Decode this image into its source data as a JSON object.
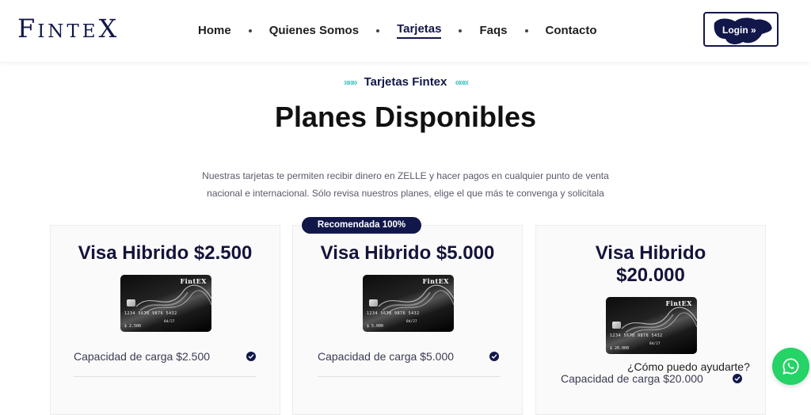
{
  "header": {
    "logo_big": "F",
    "logo_small": "INTE",
    "logo_end": "X",
    "nav": [
      {
        "label": "Home",
        "active": false
      },
      {
        "label": "Quienes Somos",
        "active": false
      },
      {
        "label": "Tarjetas",
        "active": true
      },
      {
        "label": "Faqs",
        "active": false
      },
      {
        "label": "Contacto",
        "active": false
      }
    ],
    "login_label": "Login »"
  },
  "section": {
    "eyebrow": "Tarjetas Fintex",
    "eyebrow_arrows_left": "»»»",
    "eyebrow_arrows_right": "«««",
    "title": "Planes Disponibles",
    "description_line1": "Nuestras tarjetas te permiten recibir dinero en ZELLE y hacer pagos en cualquier punto de venta",
    "description_line2": "nacional e internacional. Sólo revisa nuestros planes, elige el que más te convenga y solicitala"
  },
  "badge": "Recomendada 100%",
  "plans": [
    {
      "name": "Visa Hibrido $2.500",
      "card_brand": "FintEX",
      "card_number": "1234 5678 9876 5432",
      "card_expiry": "04/27",
      "card_amount": "$ 2.500",
      "feature": "Capacidad de carga $2.500"
    },
    {
      "name": "Visa Hibrido $5.000",
      "card_brand": "FintEX",
      "card_number": "1234 5678 9876 5432",
      "card_expiry": "04/27",
      "card_amount": "$ 5.000",
      "feature": "Capacidad de carga $5.000"
    },
    {
      "name_line1": "Visa Hibrido",
      "name_line2": "$20.000",
      "card_brand": "FintEX",
      "card_number": "1234 5678 9876 5432",
      "card_expiry": "04/27",
      "card_amount": "$ 20.000",
      "feature": "Capacidad de carga $20.000"
    }
  ],
  "help_text": "¿Cómo puedo ayudarte?",
  "colors": {
    "brand_navy": "#12174a",
    "accent_teal": "#4fc6c6",
    "whatsapp_green": "#25d366"
  },
  "icons": {
    "check": "check-circle-icon",
    "whatsapp": "whatsapp-icon"
  }
}
